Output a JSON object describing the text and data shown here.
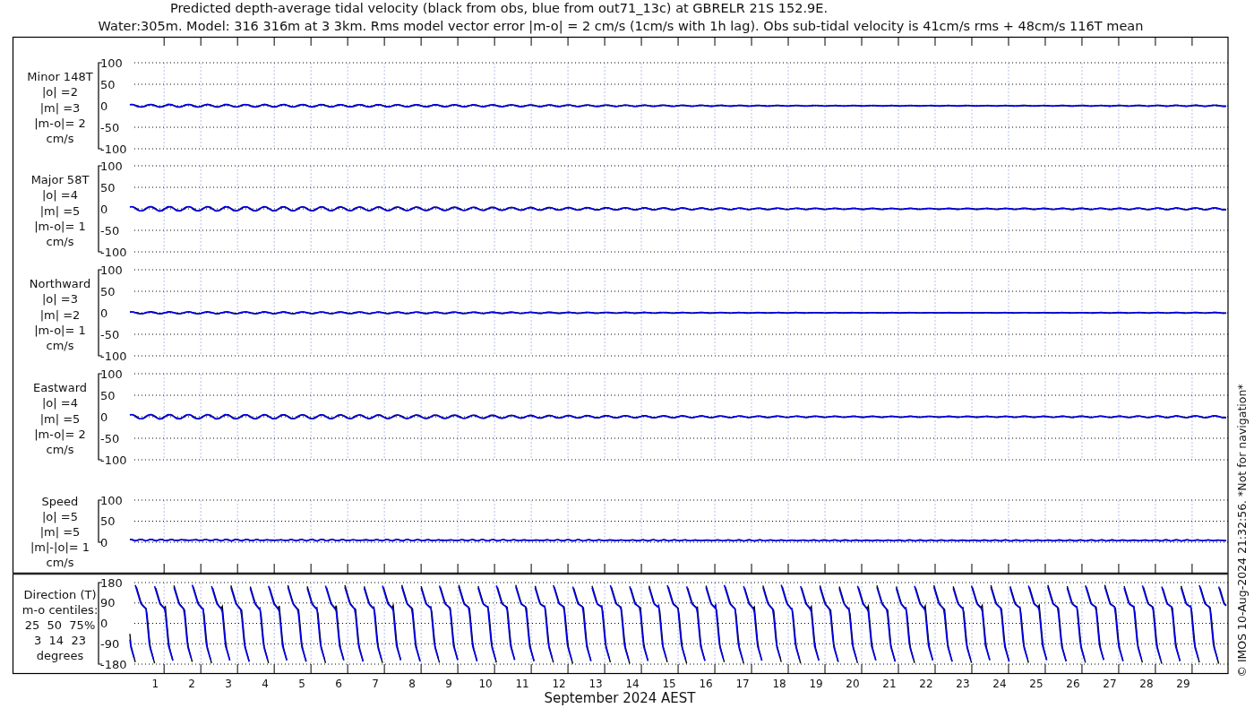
{
  "title_lines": [
    "Predicted depth-average tidal velocity (black from obs, blue from out71_13c) at GBRELR 21S 152.9E.",
    "Water:305m. Model: 316 316m at 3 3km. Rms model vector error |m-o| = 2 cm/s (1cm/s with 1h lag). Obs sub-tidal velocity is 41cm/s rms + 48cm/s 116T mean"
  ],
  "panels": [
    {
      "kind": "velocity",
      "label_lines": [
        "Minor 148T",
        "|o| =2",
        "|m| =3",
        "|m-o|= 2",
        "cm/s"
      ],
      "yticks": [
        "100",
        "50",
        "0",
        "-50",
        "-100"
      ]
    },
    {
      "kind": "velocity",
      "label_lines": [
        "Major 58T",
        "|o| =4",
        "|m| =5",
        "|m-o|= 1",
        "cm/s"
      ],
      "yticks": [
        "100",
        "50",
        "0",
        "-50",
        "-100"
      ]
    },
    {
      "kind": "velocity",
      "label_lines": [
        "Northward",
        "|o| =3",
        "|m| =2",
        "|m-o|= 1",
        "cm/s"
      ],
      "yticks": [
        "100",
        "50",
        "0",
        "-50",
        "-100"
      ]
    },
    {
      "kind": "velocity",
      "label_lines": [
        "Eastward",
        "|o| =4",
        "|m| =5",
        "|m-o|= 2",
        "cm/s"
      ],
      "yticks": [
        "100",
        "50",
        "0",
        "-50",
        "-100"
      ]
    },
    {
      "kind": "speed",
      "label_lines": [
        "Speed",
        "|o| =5",
        "|m| =5",
        "|m|-|o|= 1",
        "cm/s"
      ],
      "yticks": [
        "100",
        "50",
        "0"
      ]
    },
    {
      "kind": "direction",
      "label_lines": [
        "Direction (T)",
        "m-o centiles:",
        "25  50  75%",
        "3  14  23",
        "degrees"
      ],
      "yticks": [
        "180",
        "90",
        "0",
        "-90",
        "-180"
      ]
    }
  ],
  "xticks": [
    "1",
    "2",
    "3",
    "4",
    "5",
    "6",
    "7",
    "8",
    "9",
    "10",
    "11",
    "12",
    "13",
    "14",
    "15",
    "16",
    "17",
    "18",
    "19",
    "20",
    "21",
    "22",
    "23",
    "24",
    "25",
    "26",
    "27",
    "28",
    "29"
  ],
  "xlabel": "September 2024 AEST",
  "side_note": "© IMOS 10-Aug-2024 21:32:56. *Not for navigation*"
}
